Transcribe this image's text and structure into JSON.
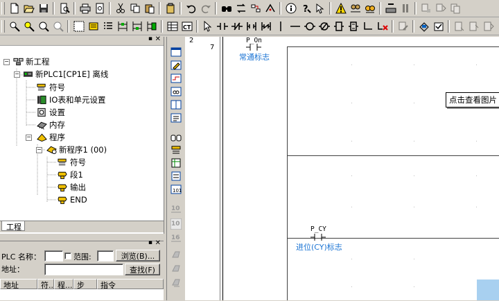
{
  "tree": {
    "project": "新工程",
    "plc": "新PLC1[CP1E] 离线",
    "symbols": "符号",
    "io_table": "IO表和单元设置",
    "settings": "设置",
    "memory": "内存",
    "programs": "程序",
    "program1": "新程序1 (00)",
    "p_symbols": "符号",
    "section1": "段1",
    "output": "输出",
    "end": "END"
  },
  "tabs": {
    "project_tab": "工程"
  },
  "search_pane": {
    "plc_label": "PLC 名称：",
    "range_label": "范围:",
    "browse_button": "浏览(B)...",
    "address_label": "地址：",
    "find_button": "查找(F)",
    "columns": [
      "地址",
      "符...",
      "程...",
      "步",
      "指令"
    ]
  },
  "ladder": {
    "rung_number": "2",
    "step_number": "7",
    "contact1_name": "P_On",
    "contact1_comment": "常通标志",
    "contact2_name": "P_CY",
    "contact2_comment": "进位(CY)标志",
    "tooltip": "点击查看图片"
  },
  "colors": {
    "comment_blue": "#1b74d4",
    "window_bg": "#d4d0c8"
  }
}
